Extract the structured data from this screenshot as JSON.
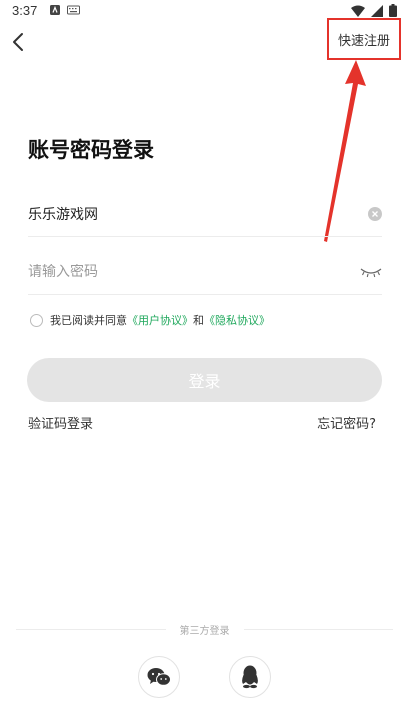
{
  "status_bar": {
    "time": "3:37"
  },
  "header": {
    "quick_register": "快速注册"
  },
  "title": "账号密码登录",
  "form": {
    "account_value": "乐乐游戏网",
    "password_placeholder": "请输入密码"
  },
  "agreement": {
    "prefix": "我已阅读并同意",
    "user_agreement": "《用户协议》",
    "and": "和",
    "privacy_agreement": "《隐私协议》"
  },
  "login_button": "登录",
  "links": {
    "sms_login": "验证码登录",
    "forgot_password": "忘记密码?"
  },
  "third_party": {
    "label": "第三方登录",
    "icons": [
      "wechat-icon",
      "qq-icon"
    ]
  },
  "colors": {
    "annotation_red": "#e4332b",
    "link_green": "#1fa85c",
    "disabled_button": "#e4e4e4"
  }
}
